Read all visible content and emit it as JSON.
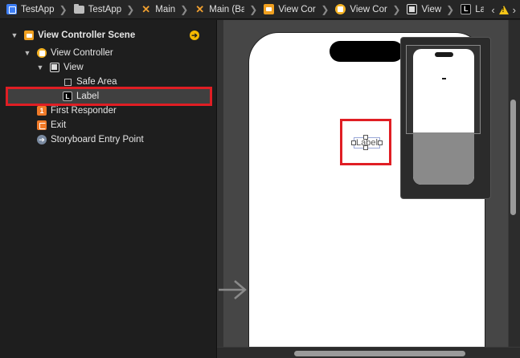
{
  "breadcrumbs": [
    {
      "label": "TestApp",
      "icon": "project-icon"
    },
    {
      "label": "TestApp",
      "icon": "folder-icon"
    },
    {
      "label": "Main",
      "icon": "storyboard-icon"
    },
    {
      "label": "Main (Ba",
      "icon": "storyboard-icon"
    },
    {
      "label": "View Cor",
      "icon": "scene-icon"
    },
    {
      "label": "View Cor",
      "icon": "view-controller-icon"
    },
    {
      "label": "View",
      "icon": "view-icon"
    },
    {
      "label": "Label",
      "icon": "label-icon"
    }
  ],
  "outline": {
    "items": [
      {
        "label": "View Controller Scene",
        "icon": "scene-icon"
      },
      {
        "label": "View Controller",
        "icon": "view-controller-icon"
      },
      {
        "label": "View",
        "icon": "view-icon"
      },
      {
        "label": "Safe Area",
        "icon": "safe-area-icon"
      },
      {
        "label": "Label",
        "icon": "label-icon",
        "selected": true
      },
      {
        "label": "First Responder",
        "icon": "first-responder-icon"
      },
      {
        "label": "Exit",
        "icon": "exit-icon"
      },
      {
        "label": "Storyboard Entry Point",
        "icon": "entry-point-icon"
      }
    ]
  },
  "canvas": {
    "label_text": "Label"
  },
  "colors": {
    "highlight": "#e01e24",
    "scene_orange": "#f0a020",
    "background": "#1e1e1e"
  }
}
